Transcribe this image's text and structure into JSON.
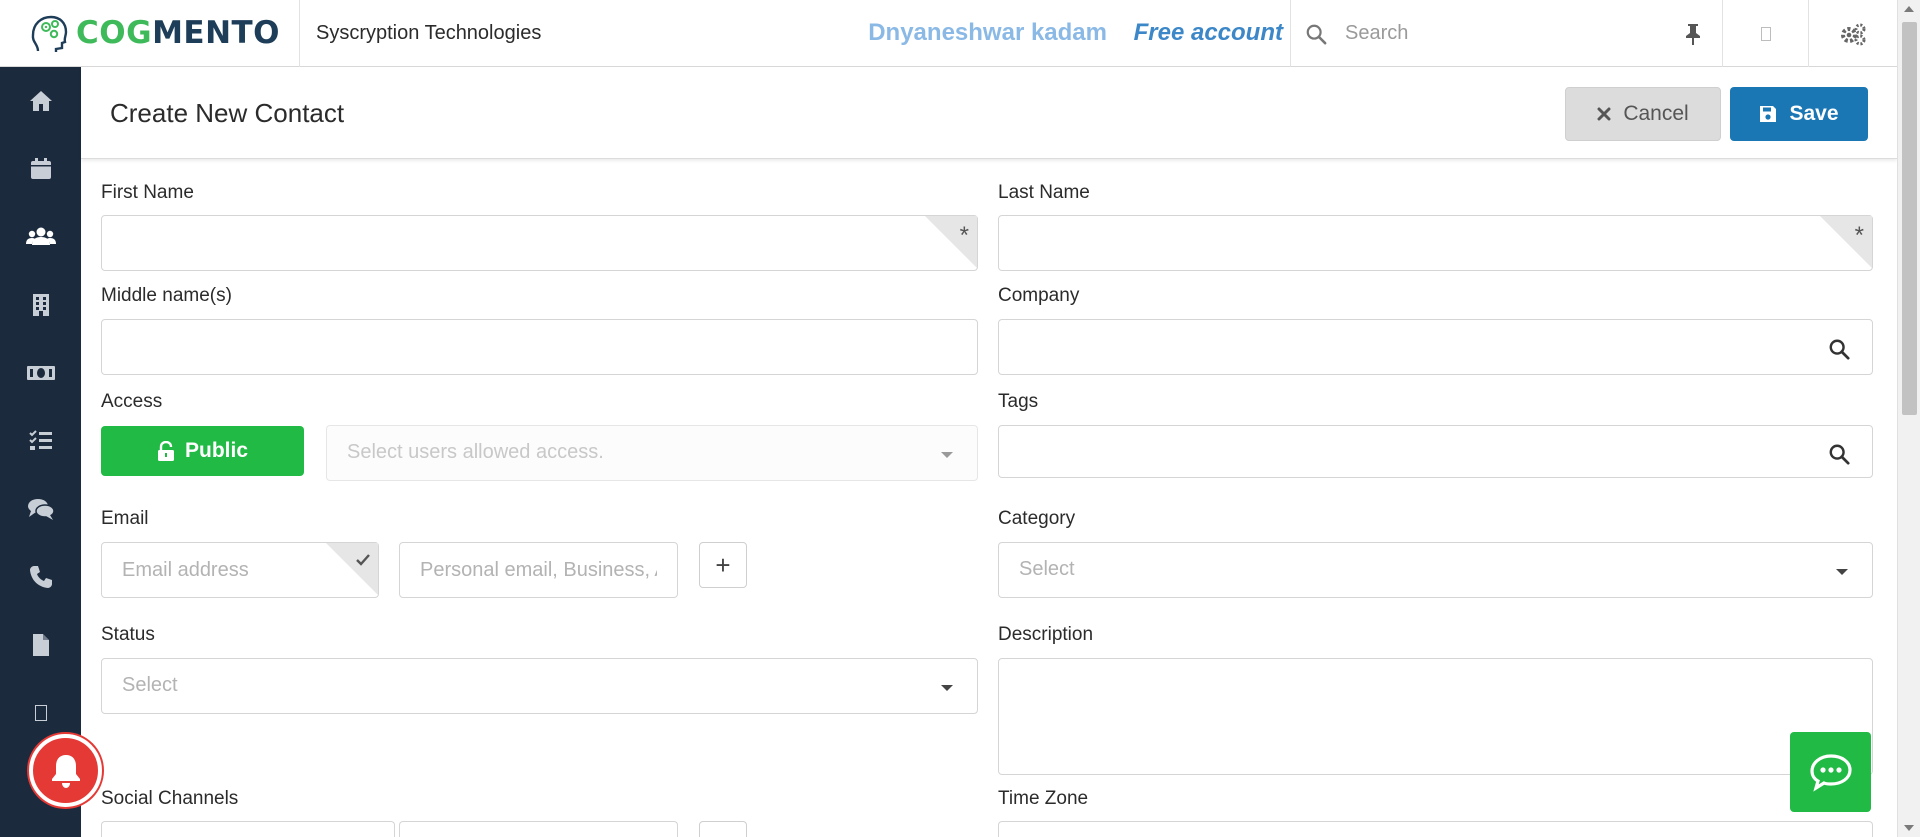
{
  "app": {
    "logo_cog": "COG",
    "logo_mento": "MENTO",
    "company": "Syscryption Technologies",
    "user_name": "Dnyaneshwar kadam",
    "plan": "Free account",
    "search_placeholder": "Search"
  },
  "page": {
    "title": "Create New Contact",
    "cancel_label": "Cancel",
    "save_label": "Save"
  },
  "form": {
    "first_name_label": "First Name",
    "last_name_label": "Last Name",
    "middle_name_label": "Middle name(s)",
    "company_label": "Company",
    "access_label": "Access",
    "access_button": "Public",
    "access_select_placeholder": "Select users allowed access.",
    "tags_label": "Tags",
    "email_label": "Email",
    "email_placeholder": "Email address",
    "email_type_placeholder": "Personal email, Business, Alt...",
    "category_label": "Category",
    "category_value": "Select",
    "status_label": "Status",
    "status_value": "Select",
    "description_label": "Description",
    "social_label": "Social Channels",
    "timezone_label": "Time Zone",
    "required_mark": "*",
    "add_symbol": "+"
  },
  "sidebar": {
    "icons": [
      "home-icon",
      "calendar-icon",
      "contacts-icon",
      "building-icon",
      "money-icon",
      "tasks-icon",
      "comments-icon",
      "phone-icon",
      "document-icon",
      "square-icon",
      "cog-icon"
    ]
  },
  "colors": {
    "brand_green": "#3fba5a",
    "brand_navy": "#1d3d58",
    "sidebar_bg": "#1b2a3d",
    "save_blue": "#1a77b4",
    "public_green": "#21ba45",
    "notification_red": "#e53935",
    "user_link": "#8ab9e6",
    "plan_link": "#3c87c8"
  }
}
